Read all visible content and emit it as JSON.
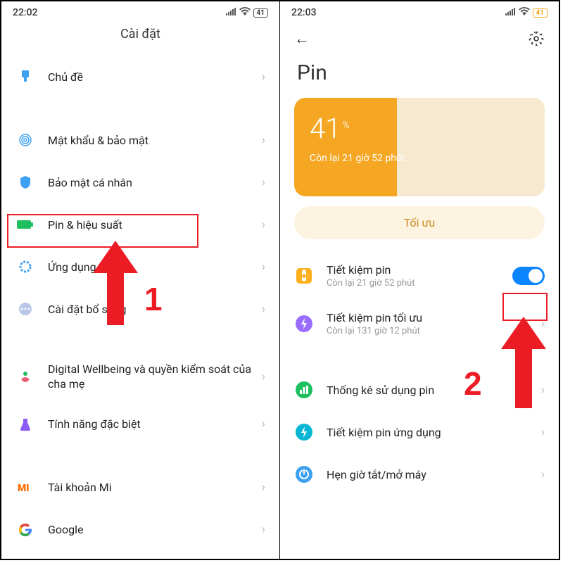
{
  "left": {
    "status": {
      "time": "22:02",
      "battery": "41"
    },
    "title": "Cài đặt",
    "items": [
      {
        "label": "Chủ đề"
      },
      {
        "label": "Mật khẩu & bảo mật"
      },
      {
        "label": "Bảo mật cá nhân"
      },
      {
        "label": "Pin & hiệu suất"
      },
      {
        "label": "Ứng dụng"
      },
      {
        "label": "Cài đặt bổ sung"
      },
      {
        "label": "Digital Wellbeing và quyền kiểm soát của cha mẹ"
      },
      {
        "label": "Tính năng đặc biệt"
      },
      {
        "label": "Tài khoản Mi"
      },
      {
        "label": "Google"
      }
    ],
    "annot_num": "1"
  },
  "right": {
    "status": {
      "time": "22:03",
      "battery": "41"
    },
    "title": "Pin",
    "battery_card": {
      "percent": "41",
      "percent_sign": "%",
      "sub": "Còn lại 21 giờ 52 phút"
    },
    "optimize": "Tối ưu",
    "saver": {
      "label": "Tiết kiệm pin",
      "sub": "Còn lại 21 giờ 52 phút"
    },
    "ultra": {
      "label": "Tiết kiệm pin tối ưu",
      "sub": "Còn lại 131 giờ 12 phút"
    },
    "stats": "Thống kê sử dụng pin",
    "app_saver": "Tiết kiệm pin ứng dụng",
    "schedule": "Hẹn giờ tắt/mở máy",
    "annot_num": "2"
  },
  "colors": {
    "accent_orange": "#f5a623",
    "accent_blue": "#0b84ff",
    "annot_red": "#ec1c24"
  }
}
